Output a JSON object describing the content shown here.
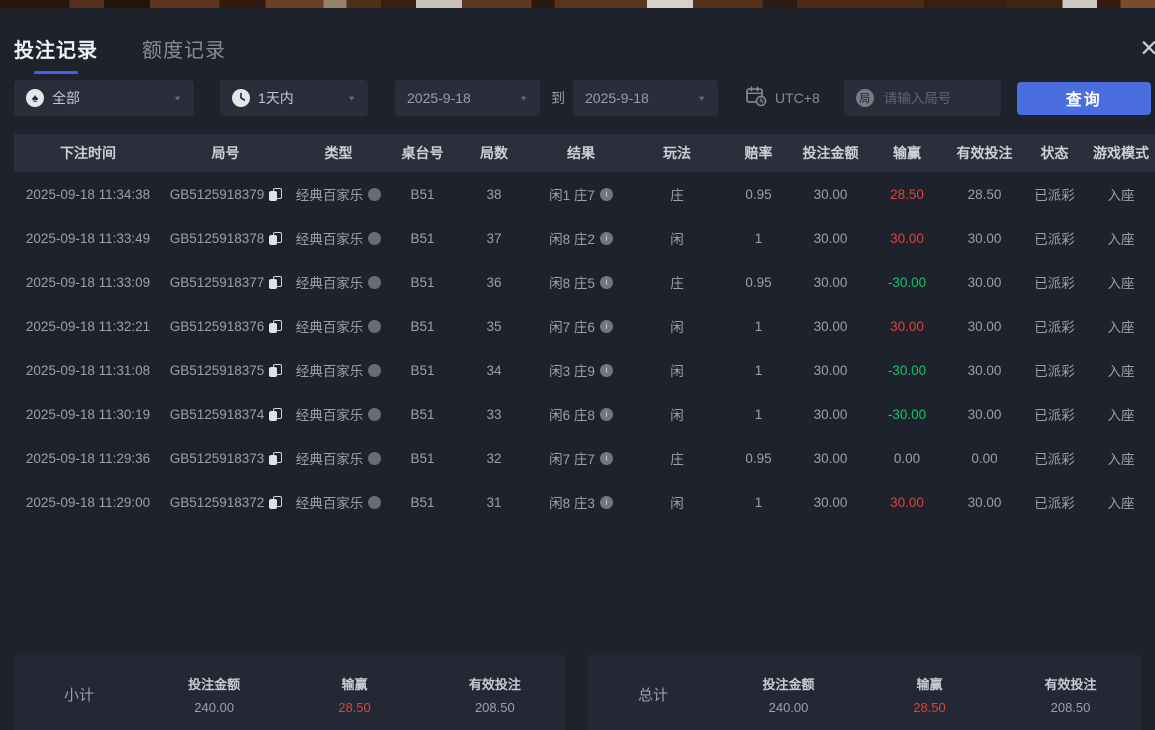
{
  "window": {
    "close_label": "✕"
  },
  "tabs": {
    "bet_record": "投注记录",
    "quota_record": "额度记录"
  },
  "filters": {
    "game_type": {
      "value": "全部",
      "icon_char": "♠"
    },
    "time_range": {
      "value": "1天内"
    },
    "date_from": "2025-9-18",
    "to_label": "到",
    "date_to": "2025-9-18",
    "timezone": "UTC+8",
    "round_input": {
      "placeholder": "请输入局号",
      "icon_char": "局"
    },
    "query_label": "查询"
  },
  "table": {
    "columns": [
      "下注时间",
      "局号",
      "类型",
      "桌台号",
      "局数",
      "结果",
      "玩法",
      "赔率",
      "投注金额",
      "输赢",
      "有效投注",
      "状态",
      "游戏模式"
    ],
    "rows": [
      {
        "time": "2025-09-18 11:34:38",
        "game_id": "GB5125918379",
        "type": "经典百家乐",
        "table_no": "B51",
        "round": "38",
        "result": "闲1 庄7",
        "play": "庄",
        "odds": "0.95",
        "bet": "30.00",
        "winloss": "28.50",
        "winloss_class": "win",
        "valid_bet": "28.50",
        "status": "已派彩",
        "mode": "入座"
      },
      {
        "time": "2025-09-18 11:33:49",
        "game_id": "GB5125918378",
        "type": "经典百家乐",
        "table_no": "B51",
        "round": "37",
        "result": "闲8 庄2",
        "play": "闲",
        "odds": "1",
        "bet": "30.00",
        "winloss": "30.00",
        "winloss_class": "win",
        "valid_bet": "30.00",
        "status": "已派彩",
        "mode": "入座"
      },
      {
        "time": "2025-09-18 11:33:09",
        "game_id": "GB5125918377",
        "type": "经典百家乐",
        "table_no": "B51",
        "round": "36",
        "result": "闲8 庄5",
        "play": "庄",
        "odds": "0.95",
        "bet": "30.00",
        "winloss": "-30.00",
        "winloss_class": "loss",
        "valid_bet": "30.00",
        "status": "已派彩",
        "mode": "入座"
      },
      {
        "time": "2025-09-18 11:32:21",
        "game_id": "GB5125918376",
        "type": "经典百家乐",
        "table_no": "B51",
        "round": "35",
        "result": "闲7 庄6",
        "play": "闲",
        "odds": "1",
        "bet": "30.00",
        "winloss": "30.00",
        "winloss_class": "win",
        "valid_bet": "30.00",
        "status": "已派彩",
        "mode": "入座"
      },
      {
        "time": "2025-09-18 11:31:08",
        "game_id": "GB5125918375",
        "type": "经典百家乐",
        "table_no": "B51",
        "round": "34",
        "result": "闲3 庄9",
        "play": "闲",
        "odds": "1",
        "bet": "30.00",
        "winloss": "-30.00",
        "winloss_class": "loss",
        "valid_bet": "30.00",
        "status": "已派彩",
        "mode": "入座"
      },
      {
        "time": "2025-09-18 11:30:19",
        "game_id": "GB5125918374",
        "type": "经典百家乐",
        "table_no": "B51",
        "round": "33",
        "result": "闲6 庄8",
        "play": "闲",
        "odds": "1",
        "bet": "30.00",
        "winloss": "-30.00",
        "winloss_class": "loss",
        "valid_bet": "30.00",
        "status": "已派彩",
        "mode": "入座"
      },
      {
        "time": "2025-09-18 11:29:36",
        "game_id": "GB5125918373",
        "type": "经典百家乐",
        "table_no": "B51",
        "round": "32",
        "result": "闲7 庄7",
        "play": "庄",
        "odds": "0.95",
        "bet": "30.00",
        "winloss": "0.00",
        "winloss_class": "zero",
        "valid_bet": "0.00",
        "status": "已派彩",
        "mode": "入座"
      },
      {
        "time": "2025-09-18 11:29:00",
        "game_id": "GB5125918372",
        "type": "经典百家乐",
        "table_no": "B51",
        "round": "31",
        "result": "闲8 庄3",
        "play": "闲",
        "odds": "1",
        "bet": "30.00",
        "winloss": "30.00",
        "winloss_class": "win",
        "valid_bet": "30.00",
        "status": "已派彩",
        "mode": "入座"
      }
    ]
  },
  "footer": {
    "subtotal": {
      "label": "小计",
      "stats": [
        {
          "label": "投注金额",
          "value": "240.00"
        },
        {
          "label": "输赢",
          "value": "28.50"
        },
        {
          "label": "有效投注",
          "value": "208.50"
        }
      ]
    },
    "total": {
      "label": "总计",
      "stats": [
        {
          "label": "投注金额",
          "value": "240.00"
        },
        {
          "label": "输赢",
          "value": "28.50"
        },
        {
          "label": "有效投注",
          "value": "208.50"
        }
      ]
    }
  },
  "colors": {
    "accent_blue": "#4a6ede",
    "tab_underline": "#3f62e8",
    "win_red": "#d9453c",
    "loss_green": "#17c168",
    "panel_bg": "#1e222c",
    "header_row_bg": "#2a2f3b"
  }
}
